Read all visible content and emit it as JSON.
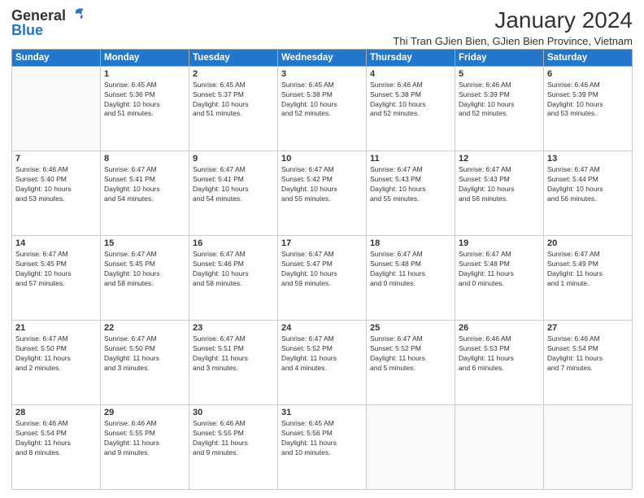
{
  "logo": {
    "general": "General",
    "blue": "Blue"
  },
  "title": "January 2024",
  "subtitle": "Thi Tran GJien Bien, GJien Bien Province, Vietnam",
  "days_of_week": [
    "Sunday",
    "Monday",
    "Tuesday",
    "Wednesday",
    "Thursday",
    "Friday",
    "Saturday"
  ],
  "weeks": [
    [
      {
        "day": "",
        "info": ""
      },
      {
        "day": "1",
        "info": "Sunrise: 6:45 AM\nSunset: 5:36 PM\nDaylight: 10 hours\nand 51 minutes."
      },
      {
        "day": "2",
        "info": "Sunrise: 6:45 AM\nSunset: 5:37 PM\nDaylight: 10 hours\nand 51 minutes."
      },
      {
        "day": "3",
        "info": "Sunrise: 6:45 AM\nSunset: 5:38 PM\nDaylight: 10 hours\nand 52 minutes."
      },
      {
        "day": "4",
        "info": "Sunrise: 6:46 AM\nSunset: 5:38 PM\nDaylight: 10 hours\nand 52 minutes."
      },
      {
        "day": "5",
        "info": "Sunrise: 6:46 AM\nSunset: 5:39 PM\nDaylight: 10 hours\nand 52 minutes."
      },
      {
        "day": "6",
        "info": "Sunrise: 6:46 AM\nSunset: 5:39 PM\nDaylight: 10 hours\nand 53 minutes."
      }
    ],
    [
      {
        "day": "7",
        "info": "Sunrise: 6:46 AM\nSunset: 5:40 PM\nDaylight: 10 hours\nand 53 minutes."
      },
      {
        "day": "8",
        "info": "Sunrise: 6:47 AM\nSunset: 5:41 PM\nDaylight: 10 hours\nand 54 minutes."
      },
      {
        "day": "9",
        "info": "Sunrise: 6:47 AM\nSunset: 5:41 PM\nDaylight: 10 hours\nand 54 minutes."
      },
      {
        "day": "10",
        "info": "Sunrise: 6:47 AM\nSunset: 5:42 PM\nDaylight: 10 hours\nand 55 minutes."
      },
      {
        "day": "11",
        "info": "Sunrise: 6:47 AM\nSunset: 5:43 PM\nDaylight: 10 hours\nand 55 minutes."
      },
      {
        "day": "12",
        "info": "Sunrise: 6:47 AM\nSunset: 5:43 PM\nDaylight: 10 hours\nand 56 minutes."
      },
      {
        "day": "13",
        "info": "Sunrise: 6:47 AM\nSunset: 5:44 PM\nDaylight: 10 hours\nand 56 minutes."
      }
    ],
    [
      {
        "day": "14",
        "info": "Sunrise: 6:47 AM\nSunset: 5:45 PM\nDaylight: 10 hours\nand 57 minutes."
      },
      {
        "day": "15",
        "info": "Sunrise: 6:47 AM\nSunset: 5:45 PM\nDaylight: 10 hours\nand 58 minutes."
      },
      {
        "day": "16",
        "info": "Sunrise: 6:47 AM\nSunset: 5:46 PM\nDaylight: 10 hours\nand 58 minutes."
      },
      {
        "day": "17",
        "info": "Sunrise: 6:47 AM\nSunset: 5:47 PM\nDaylight: 10 hours\nand 59 minutes."
      },
      {
        "day": "18",
        "info": "Sunrise: 6:47 AM\nSunset: 5:48 PM\nDaylight: 11 hours\nand 0 minutes."
      },
      {
        "day": "19",
        "info": "Sunrise: 6:47 AM\nSunset: 5:48 PM\nDaylight: 11 hours\nand 0 minutes."
      },
      {
        "day": "20",
        "info": "Sunrise: 6:47 AM\nSunset: 5:49 PM\nDaylight: 11 hours\nand 1 minute."
      }
    ],
    [
      {
        "day": "21",
        "info": "Sunrise: 6:47 AM\nSunset: 5:50 PM\nDaylight: 11 hours\nand 2 minutes."
      },
      {
        "day": "22",
        "info": "Sunrise: 6:47 AM\nSunset: 5:50 PM\nDaylight: 11 hours\nand 3 minutes."
      },
      {
        "day": "23",
        "info": "Sunrise: 6:47 AM\nSunset: 5:51 PM\nDaylight: 11 hours\nand 3 minutes."
      },
      {
        "day": "24",
        "info": "Sunrise: 6:47 AM\nSunset: 5:52 PM\nDaylight: 11 hours\nand 4 minutes."
      },
      {
        "day": "25",
        "info": "Sunrise: 6:47 AM\nSunset: 5:52 PM\nDaylight: 11 hours\nand 5 minutes."
      },
      {
        "day": "26",
        "info": "Sunrise: 6:46 AM\nSunset: 5:53 PM\nDaylight: 11 hours\nand 6 minutes."
      },
      {
        "day": "27",
        "info": "Sunrise: 6:46 AM\nSunset: 5:54 PM\nDaylight: 11 hours\nand 7 minutes."
      }
    ],
    [
      {
        "day": "28",
        "info": "Sunrise: 6:46 AM\nSunset: 5:54 PM\nDaylight: 11 hours\nand 8 minutes."
      },
      {
        "day": "29",
        "info": "Sunrise: 6:46 AM\nSunset: 5:55 PM\nDaylight: 11 hours\nand 9 minutes."
      },
      {
        "day": "30",
        "info": "Sunrise: 6:46 AM\nSunset: 5:55 PM\nDaylight: 11 hours\nand 9 minutes."
      },
      {
        "day": "31",
        "info": "Sunrise: 6:45 AM\nSunset: 5:56 PM\nDaylight: 11 hours\nand 10 minutes."
      },
      {
        "day": "",
        "info": ""
      },
      {
        "day": "",
        "info": ""
      },
      {
        "day": "",
        "info": ""
      }
    ]
  ]
}
